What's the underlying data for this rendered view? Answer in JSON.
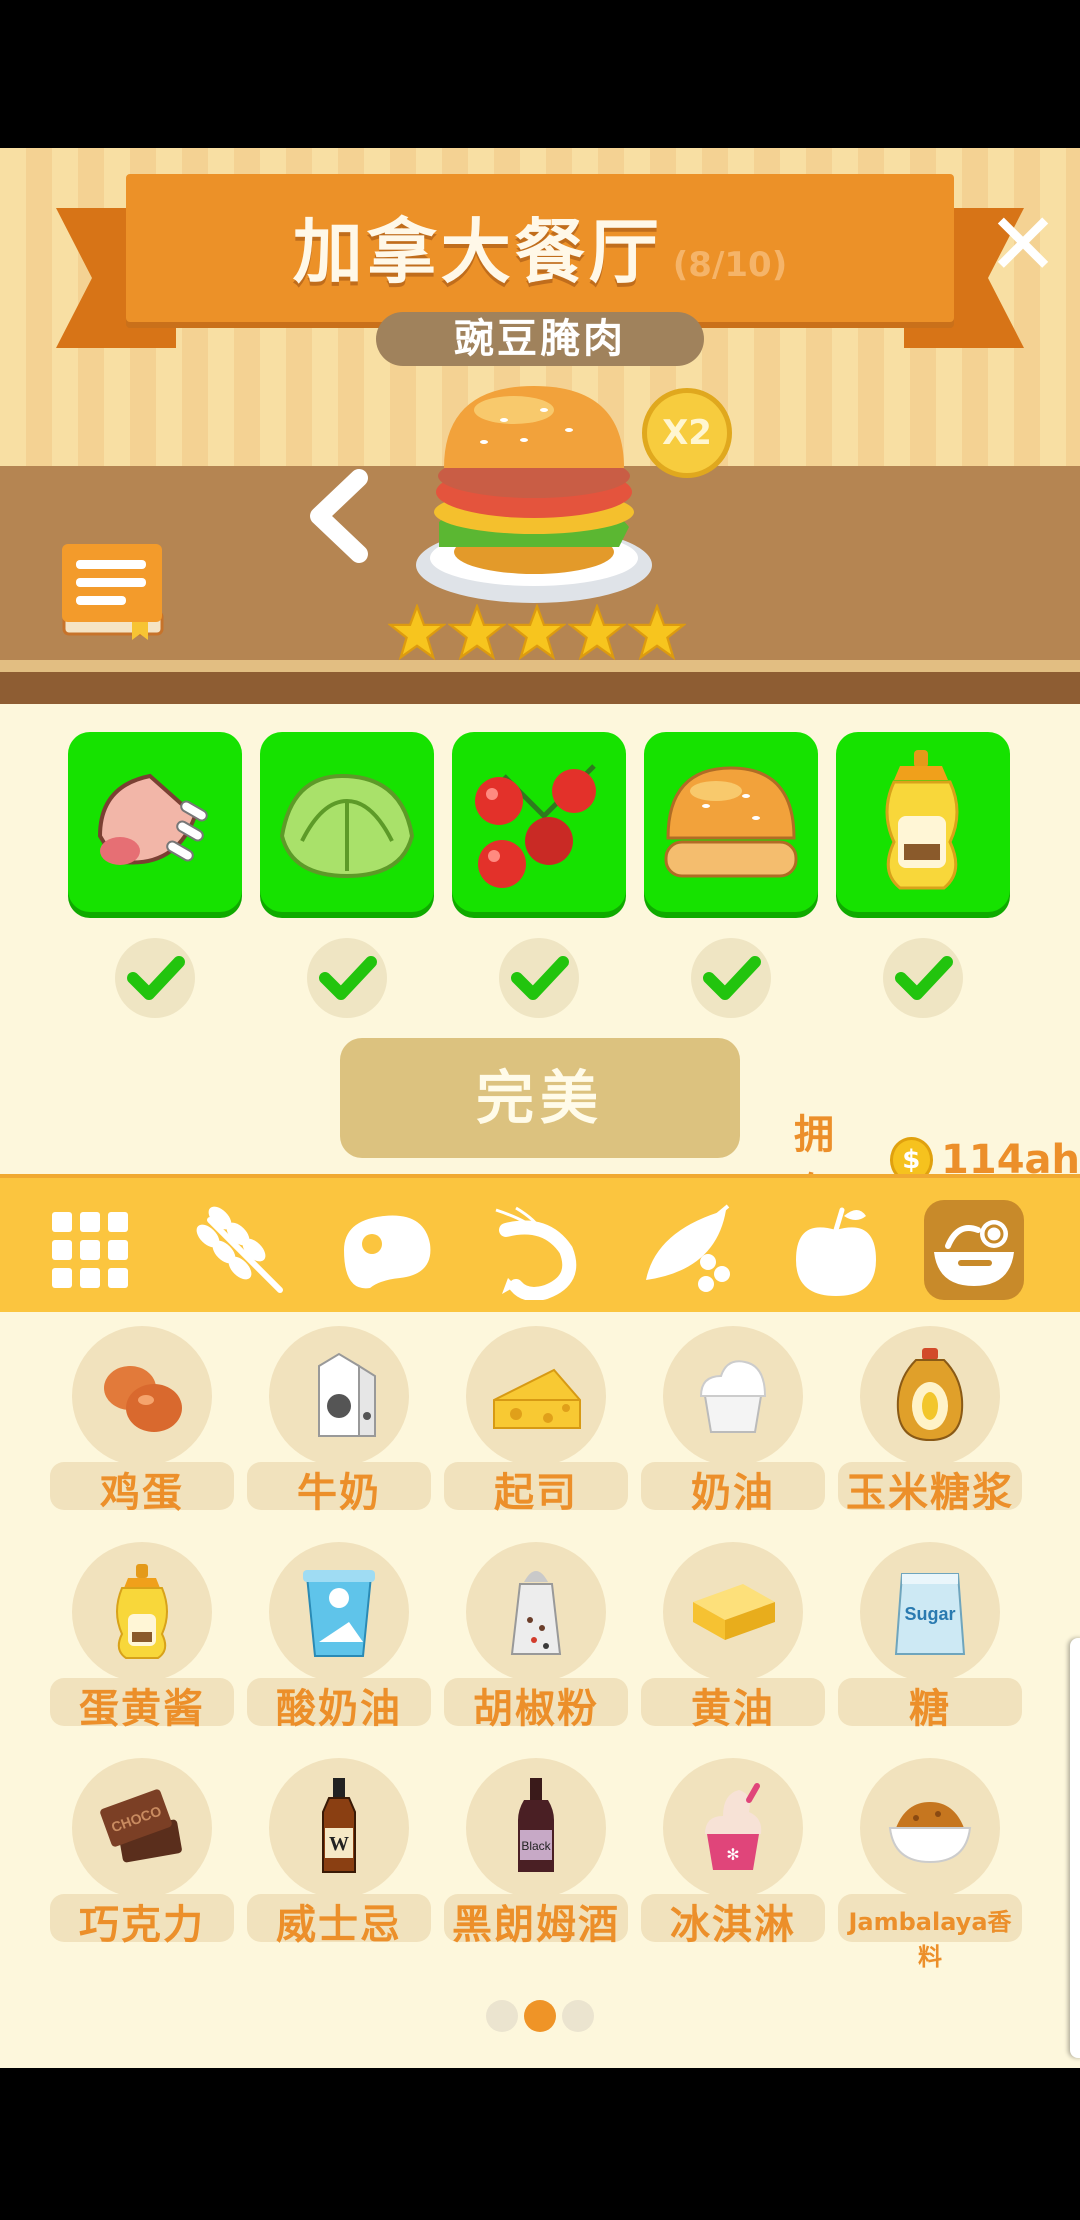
{
  "header": {
    "title": "加拿大餐厅",
    "progress": "(8/10)",
    "close_label": "✕",
    "dish_name": "豌豆腌肉",
    "multiplier": "X2",
    "star_rating": 5
  },
  "ingredients": [
    {
      "name": "pork-ribs-icon",
      "checked": true
    },
    {
      "name": "lettuce-icon",
      "checked": true
    },
    {
      "name": "tomato-icon",
      "checked": true
    },
    {
      "name": "bun-icon",
      "checked": true
    },
    {
      "name": "mustard-bottle-icon",
      "checked": true
    }
  ],
  "action": {
    "perfect_label": "完美"
  },
  "owned": {
    "label": "拥有:",
    "coin_symbol": "$",
    "amount": "114ah"
  },
  "categories": [
    {
      "name": "all-grid-icon",
      "selected": false
    },
    {
      "name": "wheat-icon",
      "selected": false
    },
    {
      "name": "steak-icon",
      "selected": false
    },
    {
      "name": "shrimp-icon",
      "selected": false
    },
    {
      "name": "pea-pod-icon",
      "selected": false
    },
    {
      "name": "apple-icon",
      "selected": false
    },
    {
      "name": "bowl-icon",
      "selected": true
    }
  ],
  "items": [
    {
      "label": "鸡蛋",
      "icon": "eggs-icon"
    },
    {
      "label": "牛奶",
      "icon": "milk-carton-icon"
    },
    {
      "label": "起司",
      "icon": "cheese-icon"
    },
    {
      "label": "奶油",
      "icon": "cream-icon"
    },
    {
      "label": "玉米糖浆",
      "icon": "corn-syrup-icon"
    },
    {
      "label": "蛋黄酱",
      "icon": "mayonnaise-icon"
    },
    {
      "label": "酸奶油",
      "icon": "sour-cream-icon"
    },
    {
      "label": "胡椒粉",
      "icon": "pepper-shaker-icon"
    },
    {
      "label": "黄油",
      "icon": "butter-icon"
    },
    {
      "label": "糖",
      "icon": "sugar-bag-icon",
      "text": "Sugar"
    },
    {
      "label": "巧克力",
      "icon": "chocolate-icon",
      "text": "CHOCO"
    },
    {
      "label": "威士忌",
      "icon": "whiskey-icon",
      "text": "W"
    },
    {
      "label": "黑朗姆酒",
      "icon": "rum-bottle-icon",
      "text": "Black"
    },
    {
      "label": "冰淇淋",
      "icon": "ice-cream-icon"
    },
    {
      "label": "Jambalaya香料",
      "icon": "spice-bowl-icon"
    }
  ],
  "pager": {
    "pages": 3,
    "current": 2
  },
  "colors": {
    "accent": "#ec8f2a",
    "tile_green": "#16e200",
    "category_bar": "#fbc53f"
  }
}
